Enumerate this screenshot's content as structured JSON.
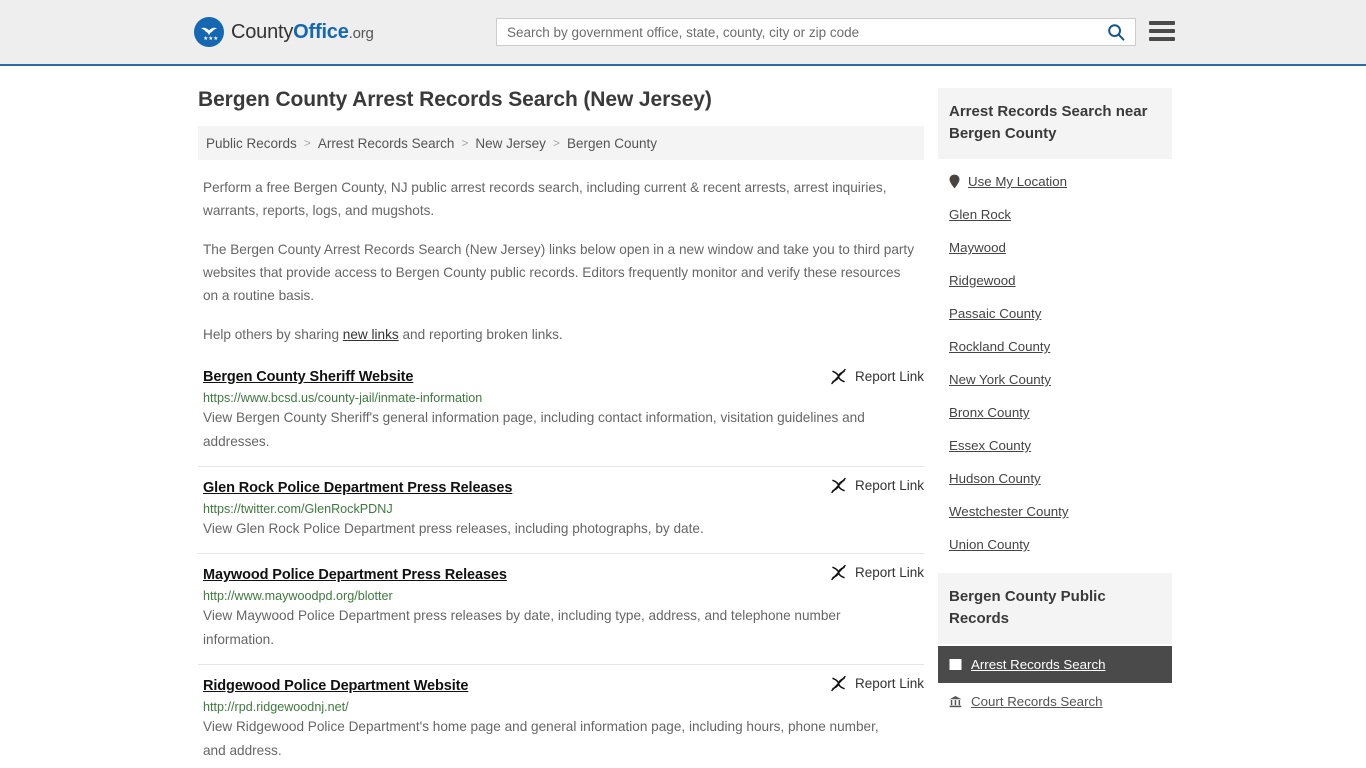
{
  "header": {
    "logo": {
      "icon": "eagle-seal-icon",
      "text_county": "County",
      "text_office": "Office",
      "text_org": ".org"
    },
    "search": {
      "placeholder": "Search by government office, state, county, city or zip code",
      "value": "",
      "search_icon": "search-icon"
    },
    "menu_icon": "hamburger-menu-icon",
    "background_color": "#eeeeee",
    "accent_color": "#2b6ca3"
  },
  "page_title": "Bergen County Arrest Records Search (New Jersey)",
  "breadcrumb": {
    "items": [
      {
        "label": "Public Records",
        "is_current": false
      },
      {
        "label": "Arrest Records Search",
        "is_current": false
      },
      {
        "label": "New Jersey",
        "is_current": false
      },
      {
        "label": "Bergen County",
        "is_current": true
      }
    ],
    "separator": ">"
  },
  "intro": {
    "paragraph1": "Perform a free Bergen County, NJ public arrest records search, including current & recent arrests, arrest inquiries, warrants, reports, logs, and mugshots.",
    "paragraph2": "The Bergen County Arrest Records Search (New Jersey) links below open in a new window and take you to third party websites that provide access to Bergen County public records. Editors frequently monitor and verify these resources on a routine basis.",
    "paragraph3_pre": "Help others by sharing ",
    "paragraph3_link": "new links",
    "paragraph3_post": " and reporting broken links."
  },
  "report_link_label": "Report Link",
  "report_link_icon": "broken-link-icon",
  "results": [
    {
      "title": "Bergen County Sheriff Website",
      "url": "https://www.bcsd.us/county-jail/inmate-information",
      "description": "View Bergen County Sheriff's general information page, including contact information, visitation guidelines and addresses."
    },
    {
      "title": "Glen Rock Police Department Press Releases",
      "url": "https://twitter.com/GlenRockPDNJ",
      "description": "View Glen Rock Police Department press releases, including photographs, by date."
    },
    {
      "title": "Maywood Police Department Press Releases",
      "url": "http://www.maywoodpd.org/blotter",
      "description": "View Maywood Police Department press releases by date, including type, address, and telephone number information."
    },
    {
      "title": "Ridgewood Police Department Website",
      "url": "http://rpd.ridgewoodnj.net/",
      "description": "View Ridgewood Police Department's home page and general information page, including hours, phone number, and address."
    }
  ],
  "sidebar": {
    "near_panel": {
      "title": "Arrest Records Search near Bergen County",
      "items": [
        {
          "label": "Use My Location",
          "icon": "map-pin-icon"
        },
        {
          "label": "Glen Rock",
          "icon": ""
        },
        {
          "label": "Maywood",
          "icon": ""
        },
        {
          "label": "Ridgewood",
          "icon": ""
        },
        {
          "label": "Passaic County",
          "icon": ""
        },
        {
          "label": "Rockland County",
          "icon": ""
        },
        {
          "label": "New York County",
          "icon": ""
        },
        {
          "label": "Bronx County",
          "icon": ""
        },
        {
          "label": "Essex County",
          "icon": ""
        },
        {
          "label": "Hudson County",
          "icon": ""
        },
        {
          "label": "Westchester County",
          "icon": ""
        },
        {
          "label": "Union County",
          "icon": ""
        }
      ]
    },
    "records_panel": {
      "title": "Bergen County Public Records",
      "items": [
        {
          "label": "Arrest Records Search",
          "icon": "document-icon",
          "active": true
        },
        {
          "label": "Court Records Search",
          "icon": "courthouse-icon",
          "active": false
        }
      ],
      "active_background": "#4a4a4a"
    }
  }
}
